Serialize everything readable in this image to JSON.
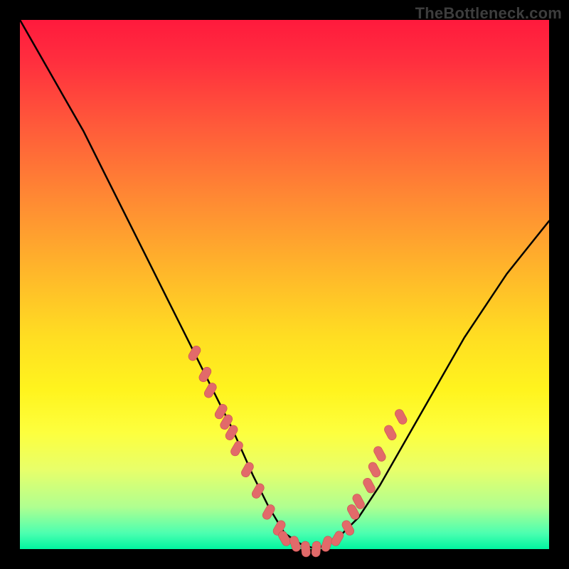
{
  "watermark": "TheBottleneck.com",
  "colors": {
    "page_bg": "#000000",
    "watermark": "#3d3d3d",
    "curve": "#000000",
    "marker_fill": "#e26a6a",
    "marker_stroke": "#c94f4f",
    "gradient_top": "#ff1a3d",
    "gradient_bottom": "#00f5a0"
  },
  "chart_data": {
    "type": "line",
    "title": "",
    "xlabel": "",
    "ylabel": "",
    "xlim": [
      0,
      100
    ],
    "ylim": [
      0,
      100
    ],
    "grid": false,
    "series": [
      {
        "name": "bottleneck-curve",
        "x": [
          0,
          4,
          8,
          12,
          16,
          20,
          24,
          28,
          32,
          36,
          40,
          44,
          47,
          50,
          53,
          56,
          60,
          64,
          68,
          72,
          76,
          80,
          84,
          88,
          92,
          96,
          100
        ],
        "values": [
          100,
          93,
          86,
          79,
          71,
          63,
          55,
          47,
          39,
          31,
          23,
          14,
          8,
          3,
          1,
          0,
          2,
          6,
          12,
          19,
          26,
          33,
          40,
          46,
          52,
          57,
          62
        ]
      }
    ],
    "markers": [
      {
        "x": 33,
        "y": 37
      },
      {
        "x": 35,
        "y": 33
      },
      {
        "x": 36,
        "y": 30
      },
      {
        "x": 38,
        "y": 26
      },
      {
        "x": 39,
        "y": 24
      },
      {
        "x": 40,
        "y": 22
      },
      {
        "x": 41,
        "y": 19
      },
      {
        "x": 43,
        "y": 15
      },
      {
        "x": 45,
        "y": 11
      },
      {
        "x": 47,
        "y": 7
      },
      {
        "x": 49,
        "y": 4
      },
      {
        "x": 50,
        "y": 2
      },
      {
        "x": 52,
        "y": 1
      },
      {
        "x": 54,
        "y": 0
      },
      {
        "x": 56,
        "y": 0
      },
      {
        "x": 58,
        "y": 1
      },
      {
        "x": 60,
        "y": 2
      },
      {
        "x": 62,
        "y": 4
      },
      {
        "x": 63,
        "y": 7
      },
      {
        "x": 64,
        "y": 9
      },
      {
        "x": 66,
        "y": 12
      },
      {
        "x": 67,
        "y": 15
      },
      {
        "x": 68,
        "y": 18
      },
      {
        "x": 70,
        "y": 22
      },
      {
        "x": 72,
        "y": 25
      }
    ]
  }
}
